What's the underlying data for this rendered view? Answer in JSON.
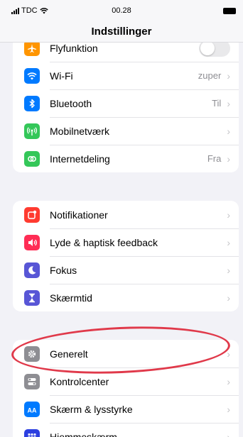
{
  "status_bar": {
    "carrier": "TDC",
    "time": "00.28"
  },
  "nav": {
    "title": "Indstillinger"
  },
  "groups": [
    [
      {
        "label": "Flyfunktion",
        "icon": "airplane-icon",
        "color": "#ff9500",
        "accessory": "toggle",
        "toggle_on": false
      },
      {
        "label": "Wi-Fi",
        "icon": "wifi-icon",
        "color": "#007aff",
        "value": "zuper"
      },
      {
        "label": "Bluetooth",
        "icon": "bluetooth-icon",
        "color": "#007aff",
        "value": "Til"
      },
      {
        "label": "Mobilnetværk",
        "icon": "antenna-icon",
        "color": "#34c759",
        "value": ""
      },
      {
        "label": "Internetdeling",
        "icon": "link-icon",
        "color": "#34c759",
        "value": "Fra"
      }
    ],
    [
      {
        "label": "Notifikationer",
        "icon": "notifications-icon",
        "color": "#ff3b30",
        "value": ""
      },
      {
        "label": "Lyde & haptisk feedback",
        "icon": "speaker-icon",
        "color": "#ff2d55",
        "value": ""
      },
      {
        "label": "Fokus",
        "icon": "moon-icon",
        "color": "#5856d6",
        "value": ""
      },
      {
        "label": "Skærmtid",
        "icon": "hourglass-icon",
        "color": "#5856d6",
        "value": ""
      }
    ],
    [
      {
        "label": "Generelt",
        "icon": "gear-icon",
        "color": "#8e8e93",
        "value": ""
      },
      {
        "label": "Kontrolcenter",
        "icon": "switches-icon",
        "color": "#8e8e93",
        "value": ""
      },
      {
        "label": "Skærm & lysstyrke",
        "icon": "text-size-icon",
        "color": "#007aff",
        "value": ""
      },
      {
        "label": "Hjemmeskærm",
        "icon": "home-grid-icon",
        "color": "#2c3fe0",
        "value": ""
      }
    ]
  ],
  "chevron": "›",
  "annotation": {
    "highlighted_item": "Generelt",
    "color": "#e0394a"
  }
}
